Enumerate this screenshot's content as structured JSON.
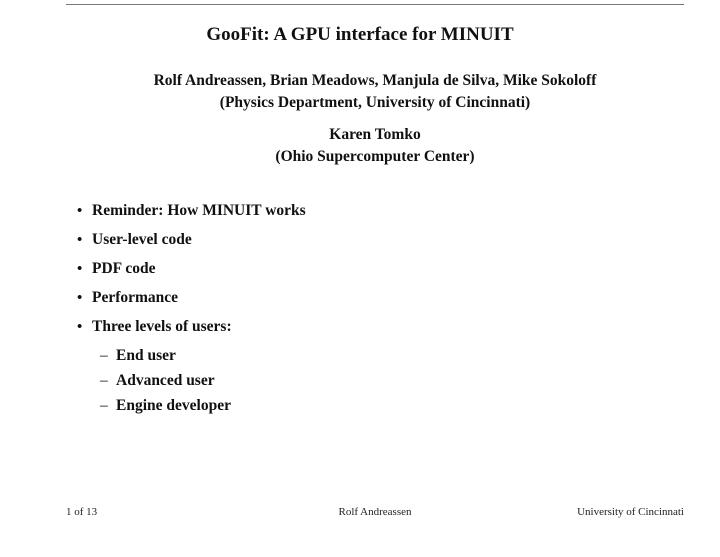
{
  "slide": {
    "title": "GooFit: A GPU interface for MINUIT",
    "authors_line1": "Rolf Andreassen, Brian Meadows, Manjula de Silva, Mike Sokoloff",
    "authors_line2": "(Physics Department, University of Cincinnati)",
    "author2_line1": "Karen Tomko",
    "author2_line2": "(Ohio Supercomputer Center)",
    "bullets": [
      "Reminder: How MINUIT works",
      "User-level code",
      "PDF code",
      "Performance",
      "Three levels of users:"
    ],
    "sub_bullets": [
      "End user",
      "Advanced user",
      "Engine developer"
    ],
    "bullet_glyph": "•",
    "dash_glyph": "–"
  },
  "footer": {
    "page": "1 of 13",
    "presenter": "Rolf Andreassen",
    "institution": "University of Cincinnati"
  }
}
